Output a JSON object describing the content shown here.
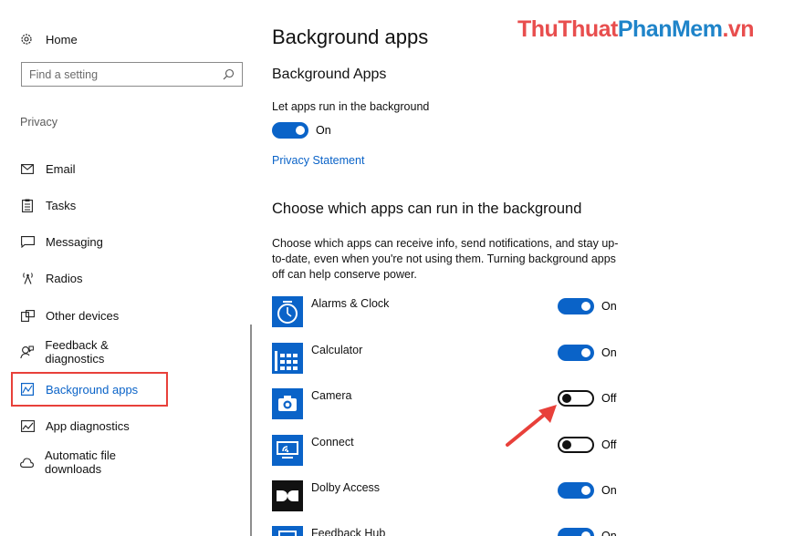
{
  "watermark": {
    "part_a": "ThuThuat",
    "part_b": "PhanMem",
    "part_c": ".vn"
  },
  "sidebar": {
    "home_label": "Home",
    "search_placeholder": "Find a setting",
    "section_label": "Privacy",
    "items": [
      {
        "label": "Email",
        "icon": "mail-icon"
      },
      {
        "label": "Tasks",
        "icon": "tasks-icon"
      },
      {
        "label": "Messaging",
        "icon": "messaging-icon"
      },
      {
        "label": "Radios",
        "icon": "radios-icon"
      },
      {
        "label": "Other devices",
        "icon": "devices-icon"
      },
      {
        "label": "Feedback & diagnostics",
        "icon": "feedback-icon"
      },
      {
        "label": "Background apps",
        "icon": "background-apps-icon",
        "active": true
      },
      {
        "label": "App diagnostics",
        "icon": "app-diagnostics-icon"
      },
      {
        "label": "Automatic file downloads",
        "icon": "cloud-icon"
      }
    ]
  },
  "main": {
    "title": "Background apps",
    "section1_title": "Background Apps",
    "run_label": "Let apps run in the background",
    "run_state": "On",
    "privacy_link": "Privacy Statement",
    "section2_title": "Choose which apps can run in the background",
    "description": "Choose which apps can receive info, send notifications, and stay up-to-date, even when you're not using them. Turning background apps off can help conserve power.",
    "apps": [
      {
        "name": "Alarms & Clock",
        "state": "On",
        "on": true,
        "icon": "alarm-clock-icon"
      },
      {
        "name": "Calculator",
        "state": "On",
        "on": true,
        "icon": "calculator-icon"
      },
      {
        "name": "Camera",
        "state": "Off",
        "on": false,
        "icon": "camera-icon"
      },
      {
        "name": "Connect",
        "state": "Off",
        "on": false,
        "icon": "connect-icon"
      },
      {
        "name": "Dolby Access",
        "state": "On",
        "on": true,
        "icon": "dolby-icon"
      },
      {
        "name": "Feedback Hub",
        "state": "On",
        "on": true,
        "icon": "feedback-hub-icon"
      }
    ]
  },
  "colors": {
    "accent": "#0a63c8",
    "highlight": "#e8403a",
    "app_tile": "#0a63c8"
  }
}
